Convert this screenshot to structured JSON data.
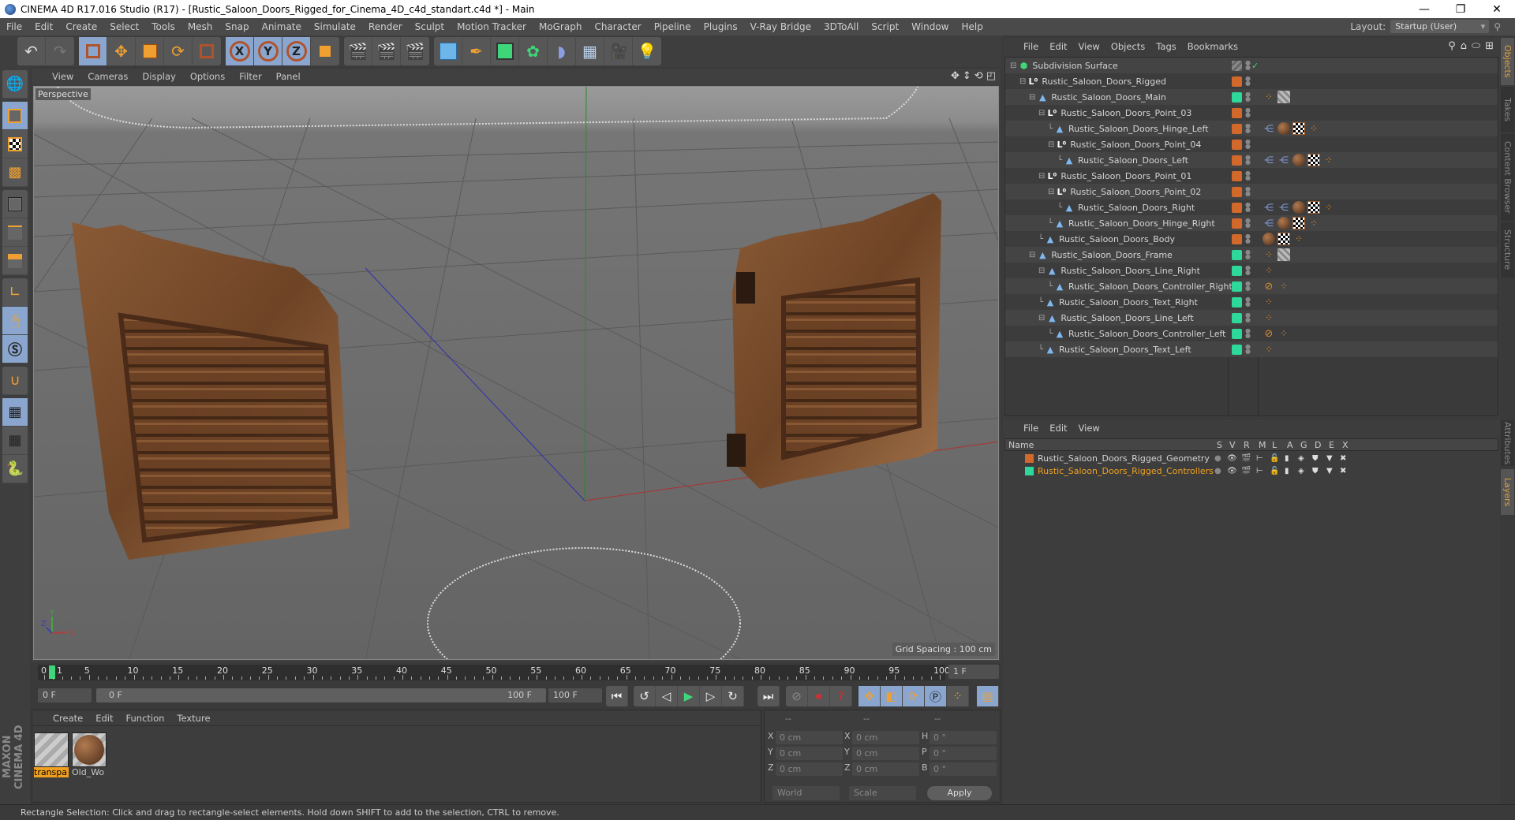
{
  "window": {
    "title": "CINEMA 4D R17.016 Studio (R17) - [Rustic_Saloon_Doors_Rigged_for_Cinema_4D_c4d_standart.c4d *] - Main",
    "controls": [
      "minimize",
      "restore",
      "close"
    ]
  },
  "menubar": {
    "items": [
      "File",
      "Edit",
      "Create",
      "Select",
      "Tools",
      "Mesh",
      "Snap",
      "Animate",
      "Simulate",
      "Render",
      "Sculpt",
      "Motion Tracker",
      "MoGraph",
      "Character",
      "Pipeline",
      "Plugins",
      "V-Ray Bridge",
      "3DToAll",
      "Script",
      "Window",
      "Help"
    ],
    "layout_label": "Layout:",
    "layout_value": "Startup (User)"
  },
  "toolbar": {
    "groups": [
      [
        "undo-icon",
        "redo-icon"
      ],
      [
        "live-selection-icon",
        "move-icon",
        "scale-icon",
        "rotate-icon",
        "recent-tool-icon"
      ],
      [
        "x-axis-lock-icon",
        "y-axis-lock-icon",
        "z-axis-lock-icon",
        "coordinate-system-icon"
      ],
      [
        "render-view-icon",
        "render-picture-viewer-icon",
        "render-settings-icon"
      ],
      [
        "cube-icon",
        "pen-spline-icon",
        "subdivision-surface-icon",
        "array-cloner-icon",
        "bend-deformer-icon",
        "floor-icon",
        "camera-icon",
        "light-icon"
      ]
    ]
  },
  "left_tools": [
    "make-editable-icon",
    "model-mode-icon",
    "texture-mode-icon",
    "workplane-mode-icon",
    "points-mode-icon",
    "edges-mode-icon",
    "polygons-mode-icon",
    "axis-mode-icon",
    "tweak-mode-icon",
    "solo-mode-icon",
    "snap-icon",
    "lock-workplane-icon",
    "workplane-icon",
    "python-icon"
  ],
  "viewport": {
    "menu": [
      "View",
      "Cameras",
      "Display",
      "Options",
      "Filter",
      "Panel"
    ],
    "camera_label": "Perspective",
    "grid_spacing": "Grid Spacing : 100 cm",
    "axis_labels": {
      "x": "X",
      "y": "Y",
      "z": "Z"
    }
  },
  "timeline": {
    "ticks": [
      "0",
      "5",
      "10",
      "15",
      "20",
      "25",
      "30",
      "35",
      "40",
      "45",
      "50",
      "55",
      "60",
      "65",
      "70",
      "75",
      "80",
      "85",
      "90",
      "95",
      "100"
    ],
    "current_frame_marker": "1",
    "current_frame_field": "1 F",
    "start_field": "0 F",
    "range_start": "0 F",
    "range_end": "100 F",
    "end_field": "100 F"
  },
  "material_panel": {
    "menu": [
      "Create",
      "Edit",
      "Function",
      "Texture"
    ],
    "materials": [
      {
        "label": "transpa",
        "selected": true
      },
      {
        "label": "Old_Wo",
        "selected": false
      }
    ]
  },
  "coord_panel": {
    "headers": [
      "--",
      "--",
      "--"
    ],
    "rows": [
      {
        "a": "X",
        "av": "0 cm",
        "b": "X",
        "bv": "0 cm",
        "c": "H",
        "cv": "0 °"
      },
      {
        "a": "Y",
        "av": "0 cm",
        "b": "Y",
        "bv": "0 cm",
        "c": "P",
        "cv": "0 °"
      },
      {
        "a": "Z",
        "av": "0 cm",
        "b": "Z",
        "bv": "0 cm",
        "c": "B",
        "cv": "0 °"
      }
    ],
    "space_select": "World",
    "mode_select": "Scale",
    "apply_label": "Apply"
  },
  "object_manager": {
    "menu": [
      "File",
      "Edit",
      "View",
      "Objects",
      "Tags",
      "Bookmarks"
    ],
    "objects": [
      {
        "name": "Subdivision Surface",
        "depth": 0,
        "type": "subdivision",
        "layer": "none",
        "tags": []
      },
      {
        "name": "Rustic_Saloon_Doors_Rigged",
        "depth": 1,
        "type": "null",
        "layer": "orange",
        "tags": []
      },
      {
        "name": "Rustic_Saloon_Doors_Main",
        "depth": 2,
        "type": "poly",
        "layer": "green",
        "tags": [
          "dots",
          "trans"
        ]
      },
      {
        "name": "Rustic_Saloon_Doors_Point_03",
        "depth": 3,
        "type": "null",
        "layer": "orange",
        "tags": []
      },
      {
        "name": "Rustic_Saloon_Doors_Hinge_Left",
        "depth": 4,
        "type": "poly",
        "layer": "orange",
        "tags": [
          "ik",
          "mat",
          "tex",
          "dots"
        ]
      },
      {
        "name": "Rustic_Saloon_Doors_Point_04",
        "depth": 4,
        "type": "null",
        "layer": "orange",
        "tags": []
      },
      {
        "name": "Rustic_Saloon_Doors_Left",
        "depth": 5,
        "type": "poly",
        "layer": "orange",
        "tags": [
          "ik",
          "ik",
          "mat",
          "tex",
          "dots"
        ]
      },
      {
        "name": "Rustic_Saloon_Doors_Point_01",
        "depth": 3,
        "type": "null",
        "layer": "orange",
        "tags": []
      },
      {
        "name": "Rustic_Saloon_Doors_Point_02",
        "depth": 4,
        "type": "null",
        "layer": "orange",
        "tags": []
      },
      {
        "name": "Rustic_Saloon_Doors_Right",
        "depth": 5,
        "type": "poly",
        "layer": "orange",
        "tags": [
          "ik",
          "ik",
          "mat",
          "tex",
          "dots"
        ]
      },
      {
        "name": "Rustic_Saloon_Doors_Hinge_Right",
        "depth": 4,
        "type": "poly",
        "layer": "orange",
        "tags": [
          "ik",
          "mat",
          "tex",
          "dots"
        ]
      },
      {
        "name": "Rustic_Saloon_Doors_Body",
        "depth": 3,
        "type": "poly",
        "layer": "orange",
        "tags": [
          "mat",
          "tex",
          "dots"
        ]
      },
      {
        "name": "Rustic_Saloon_Doors_Frame",
        "depth": 2,
        "type": "poly",
        "layer": "green",
        "tags": [
          "dots",
          "trans"
        ]
      },
      {
        "name": "Rustic_Saloon_Doors_Line_Right",
        "depth": 3,
        "type": "poly",
        "layer": "green",
        "tags": [
          "dots"
        ]
      },
      {
        "name": "Rustic_Saloon_Doors_Controller_Right",
        "depth": 4,
        "type": "poly",
        "layer": "green",
        "tags": [
          "no",
          "dots"
        ]
      },
      {
        "name": "Rustic_Saloon_Doors_Text_Right",
        "depth": 3,
        "type": "poly",
        "layer": "green",
        "tags": [
          "dots"
        ]
      },
      {
        "name": "Rustic_Saloon_Doors_Line_Left",
        "depth": 3,
        "type": "poly",
        "layer": "green",
        "tags": [
          "dots"
        ]
      },
      {
        "name": "Rustic_Saloon_Doors_Controller_Left",
        "depth": 4,
        "type": "poly",
        "layer": "green",
        "tags": [
          "no",
          "dots"
        ]
      },
      {
        "name": "Rustic_Saloon_Doors_Text_Left",
        "depth": 3,
        "type": "poly",
        "layer": "green",
        "tags": [
          "dots"
        ]
      }
    ]
  },
  "layer_manager": {
    "menu": [
      "File",
      "Edit",
      "View"
    ],
    "columns": [
      "Name",
      "S",
      "V",
      "R",
      "M",
      "L",
      "A",
      "G",
      "D",
      "E",
      "X"
    ],
    "layers": [
      {
        "name": "Rustic_Saloon_Doors_Rigged_Geometry",
        "color": "#d2692a",
        "highlight": false
      },
      {
        "name": "Rustic_Saloon_Doors_Rigged_Controllers",
        "color": "#2ed89a",
        "highlight": true
      }
    ]
  },
  "side_tabs": {
    "top": [
      "Objects",
      "Takes",
      "Content Browser",
      "Structure"
    ],
    "bottom": [
      "Attributes",
      "Layers"
    ]
  },
  "branding": "MAXON CINEMA 4D",
  "status": "Rectangle Selection: Click and drag to rectangle-select elements. Hold down SHIFT to add to the selection, CTRL to remove.",
  "colors": {
    "layer_orange": "#d2692a",
    "layer_green": "#2ed89a",
    "selected_highlight": "#f0a020",
    "active_tool_blue": "#8aa6cf"
  }
}
